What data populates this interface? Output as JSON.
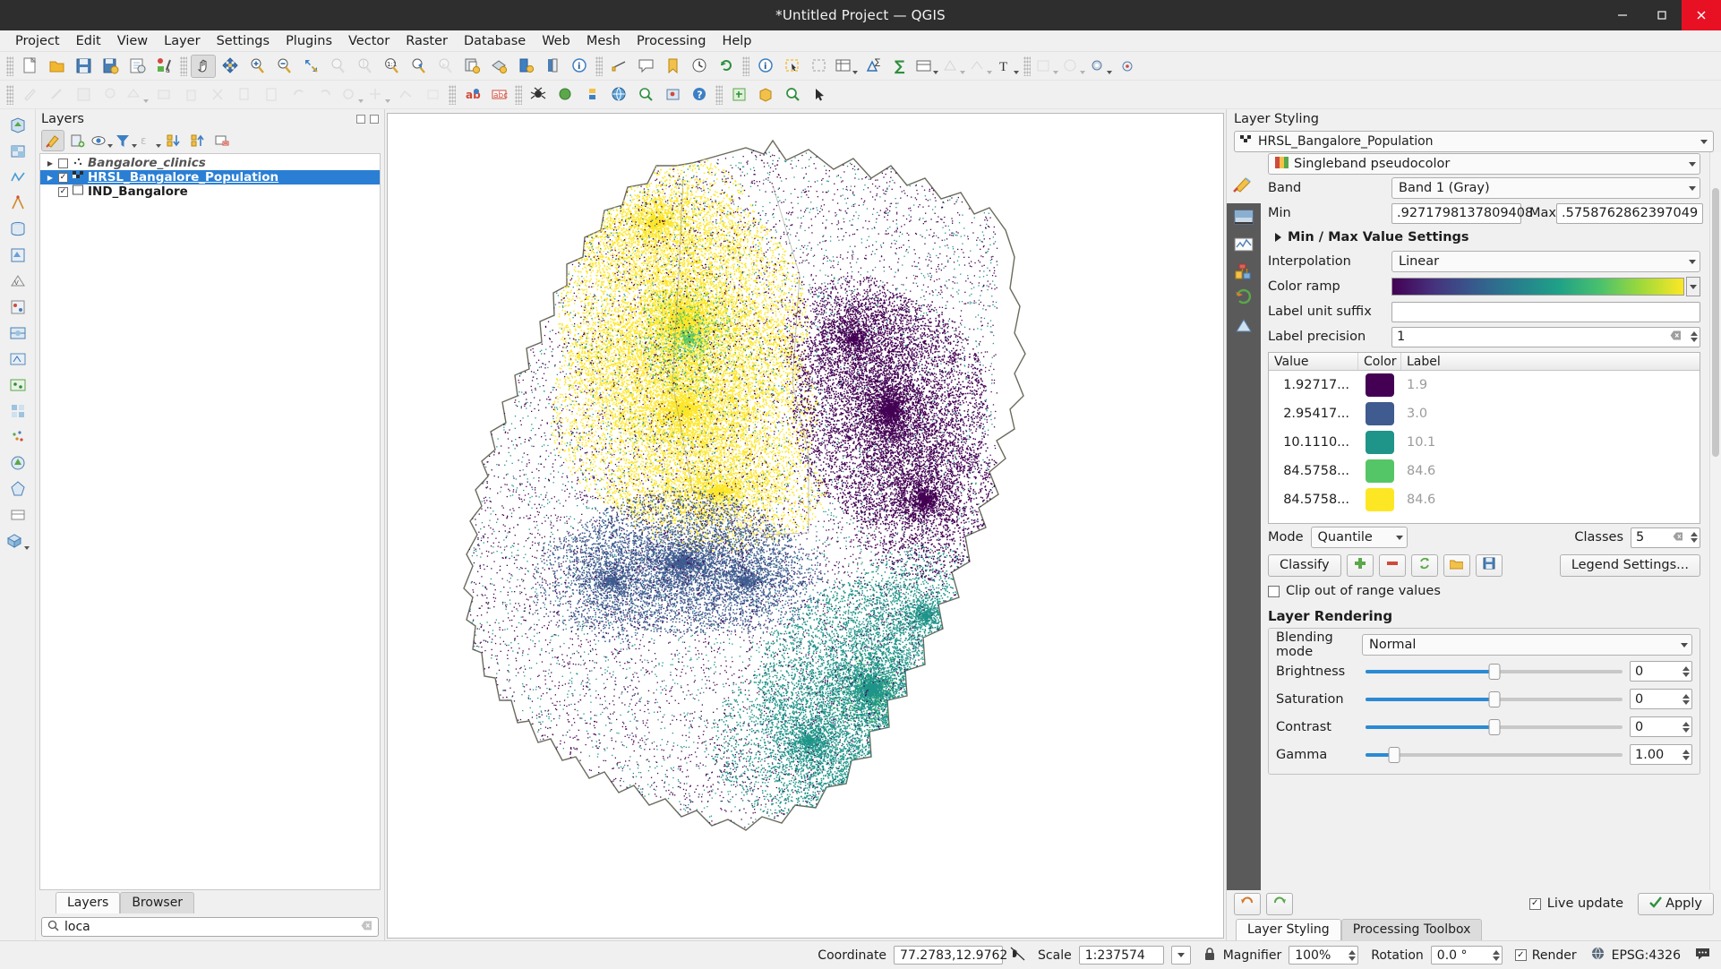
{
  "window": {
    "title": "*Untitled Project — QGIS",
    "minimize": "—",
    "maximize": "▢",
    "close": "✕"
  },
  "menubar": [
    {
      "label": "Project"
    },
    {
      "label": "Edit"
    },
    {
      "label": "View"
    },
    {
      "label": "Layer"
    },
    {
      "label": "Settings"
    },
    {
      "label": "Plugins"
    },
    {
      "label": "Vector"
    },
    {
      "label": "Raster"
    },
    {
      "label": "Database"
    },
    {
      "label": "Web"
    },
    {
      "label": "Mesh"
    },
    {
      "label": "Processing"
    },
    {
      "label": "Help"
    }
  ],
  "layers_panel": {
    "title": "Layers",
    "toolbar_icons": [
      "open-layer-styling-icon",
      "add-group-icon",
      "manage-visibility-icon",
      "filter-legend-icon",
      "expression-filter-icon",
      "expand-all-icon",
      "collapse-all-icon",
      "remove-layer-icon"
    ],
    "items": [
      {
        "name": "Bangalore_clinics",
        "checked": false,
        "expandable": true,
        "selected": false,
        "style": "italic",
        "icon": "point-layer-icon"
      },
      {
        "name": "HRSL_Bangalore_Population",
        "checked": true,
        "expandable": true,
        "selected": true,
        "style": "underline",
        "icon": "raster-layer-icon"
      },
      {
        "name": "IND_Bangalore",
        "checked": true,
        "expandable": false,
        "selected": false,
        "style": "bold",
        "icon": "polygon-layer-icon"
      }
    ],
    "tabs": [
      {
        "label": "Layers",
        "active": true
      },
      {
        "label": "Browser",
        "active": false
      }
    ],
    "search": {
      "value": "loca",
      "icon": "search-icon",
      "clear": "clear-icon"
    }
  },
  "style_panel": {
    "title": "Layer Styling",
    "layer_combo": "HRSL_Bangalore_Population",
    "renderer": "Singleband pseudocolor",
    "band_label": "Band",
    "band_value": "Band 1 (Gray)",
    "min_label": "Min",
    "min_value": ".9271798137809408",
    "max_label": "Max",
    "max_value": ".5758762862397049",
    "minmax_section": "Min / Max Value Settings",
    "interpolation_label": "Interpolation",
    "interpolation_value": "Linear",
    "colorramp_label": "Color ramp",
    "label_unit_suffix_label": "Label unit suffix",
    "label_unit_suffix_value": "",
    "label_precision_label": "Label precision",
    "label_precision_value": "1",
    "table": {
      "headers": [
        "Value",
        "Color",
        "Label"
      ],
      "rows": [
        {
          "value": "1.92717...",
          "color": "#440154",
          "label": "1.9"
        },
        {
          "value": "2.95417...",
          "color": "#3f5b8f",
          "label": "3.0"
        },
        {
          "value": "10.1110...",
          "color": "#1f9489",
          "label": "10.1"
        },
        {
          "value": "84.5758...",
          "color": "#55c667",
          "label": "84.6"
        },
        {
          "value": "84.5758...",
          "color": "#fde725",
          "label": "84.6"
        }
      ]
    },
    "mode_label": "Mode",
    "mode_value": "Quantile",
    "classes_label": "Classes",
    "classes_value": "5",
    "classify_button": "Classify",
    "add_button_icon": "add-value-icon",
    "remove_button_icon": "remove-value-icon",
    "sort_button_icon": "sort-values-icon",
    "load_button_icon": "load-colormap-icon",
    "save_button_icon": "save-colormap-icon",
    "legend_settings_button": "Legend Settings...",
    "clip_label": "Clip out of range values",
    "clip_checked": false,
    "rendering_header": "Layer Rendering",
    "blending_label": "Blending mode",
    "blending_value": "Normal",
    "sliders": [
      {
        "label": "Brightness",
        "value": "0",
        "pos": 50
      },
      {
        "label": "Saturation",
        "value": "0",
        "pos": 50
      },
      {
        "label": "Contrast",
        "value": "0",
        "pos": 50
      },
      {
        "label": "Gamma",
        "value": "1.00",
        "pos": 11
      }
    ],
    "undo_icon": "undo-icon",
    "redo_icon": "redo-icon",
    "live_update_label": "Live update",
    "live_update_checked": true,
    "apply_button": "Apply",
    "tabs": [
      {
        "label": "Layer Styling",
        "active": true
      },
      {
        "label": "Processing Toolbox",
        "active": false
      }
    ]
  },
  "statusbar": {
    "coordinate_label": "Coordinate",
    "coordinate_value": "77.2783,12.9762",
    "toggle_extents_icon": "toggle-extents-icon",
    "scale_label": "Scale",
    "scale_value": "1:237574",
    "lock_icon": "lock-icon",
    "magnifier_label": "Magnifier",
    "magnifier_value": "100%",
    "rotation_label": "Rotation",
    "rotation_value": "0.0 °",
    "render_label": "Render",
    "render_checked": true,
    "crs_label": "EPSG:4326",
    "crs_icon": "globe-icon",
    "messages_icon": "messages-icon"
  },
  "map": {
    "description": "Bangalore district boundary with HRSL population raster points colored by viridis quantile classes",
    "colors": {
      "yellow": "#fde725",
      "green": "#55c667",
      "teal": "#1f9489",
      "blue": "#3f5b8f",
      "purple": "#440154",
      "boundary": "#6b6b5e"
    }
  }
}
